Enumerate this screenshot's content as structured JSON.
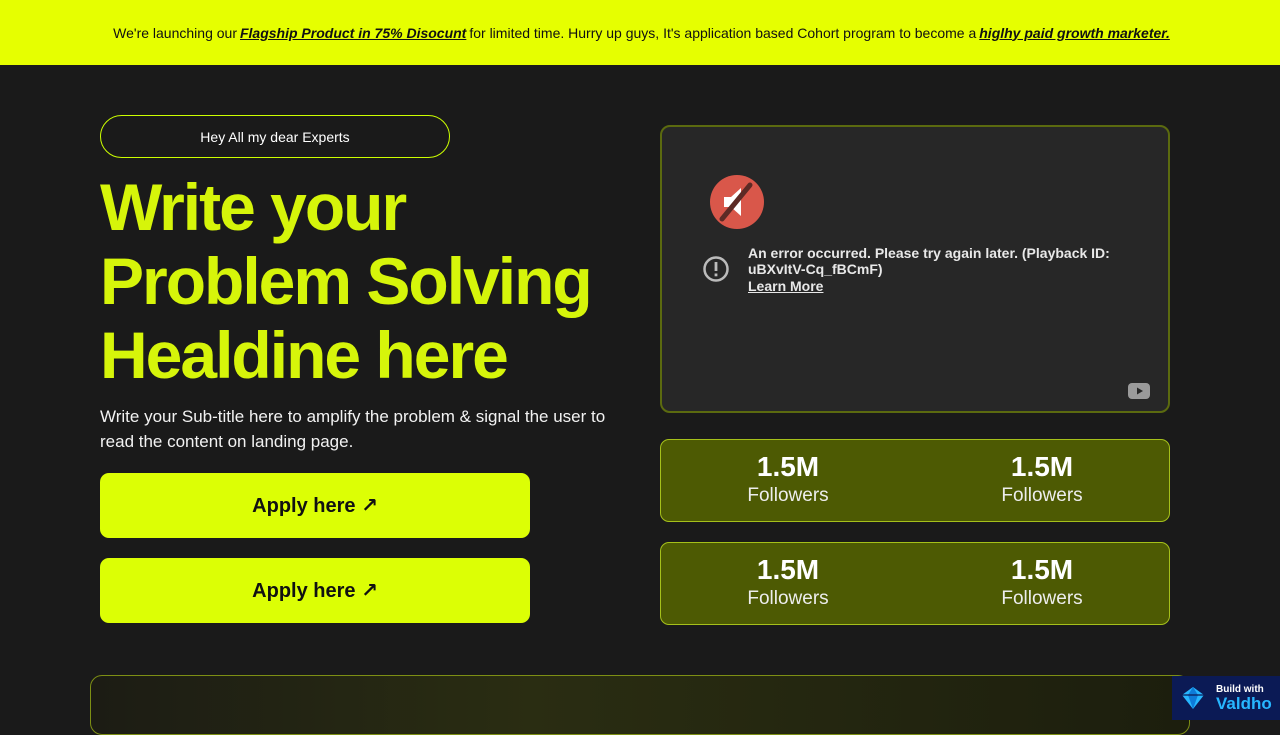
{
  "banner": {
    "text_1": "We're launching our",
    "link_1": "Flagship Product in 75% Disocunt",
    "text_2": "for limited time. Hurry up guys, It's application based Cohort program to become a",
    "link_2": "higlhy paid growth marketer."
  },
  "hero": {
    "pill": "Hey All my dear Experts",
    "headline": "Write your Problem Solving Healdine here",
    "subtitle": "Write your Sub-title here to amplify the problem & signal the user to read the content on landing page.",
    "apply_1": "Apply here ↗",
    "apply_2": "Apply here ↗"
  },
  "video": {
    "error": "An error occurred. Please try again later. (Playback ID: uBXvItV-Cq_fBCmF)",
    "learn_more": "Learn More",
    "icons": [
      "muted-speaker-icon",
      "error-icon",
      "youtube-icon"
    ]
  },
  "stats": [
    {
      "value": "1.5M",
      "label": "Followers"
    },
    {
      "value": "1.5M",
      "label": "Followers"
    },
    {
      "value": "1.5M",
      "label": "Followers"
    },
    {
      "value": "1.5M",
      "label": "Followers"
    }
  ],
  "badge": {
    "small": "Build with",
    "big": "Valdho"
  },
  "colors": {
    "accent": "#dcff05",
    "background": "#1a1a1a",
    "stat_bg": "#4d5a03"
  }
}
